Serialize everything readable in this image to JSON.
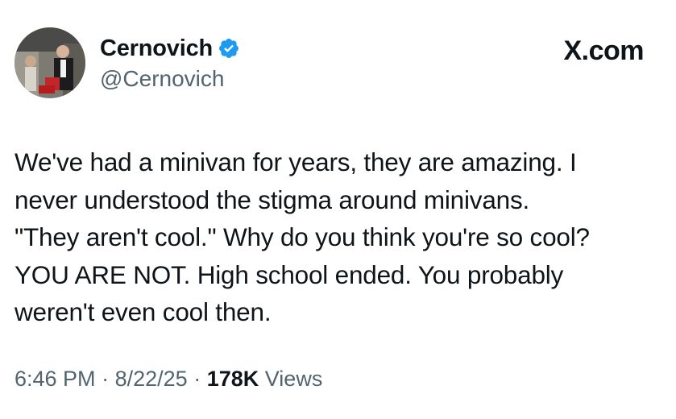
{
  "author": {
    "display_name": "Cernovich",
    "handle": "@Cernovich",
    "verified": true,
    "verified_color": "#1d9bf0"
  },
  "brand": {
    "label": "X.com"
  },
  "tweet": {
    "lines": [
      "We've had a minivan for years, they are amazing. I",
      "never understood the stigma around minivans.",
      "\"They aren't cool.\" Why do you think you're so cool?",
      "YOU ARE NOT. High school ended. You probably",
      "weren't even cool then."
    ]
  },
  "meta": {
    "time": "6:46 PM",
    "sep1": "·",
    "date": "8/22/25",
    "sep2": "·",
    "views_count": "178K",
    "views_label": "Views"
  },
  "colors": {
    "text": "#0f1419",
    "secondary": "#536471"
  }
}
